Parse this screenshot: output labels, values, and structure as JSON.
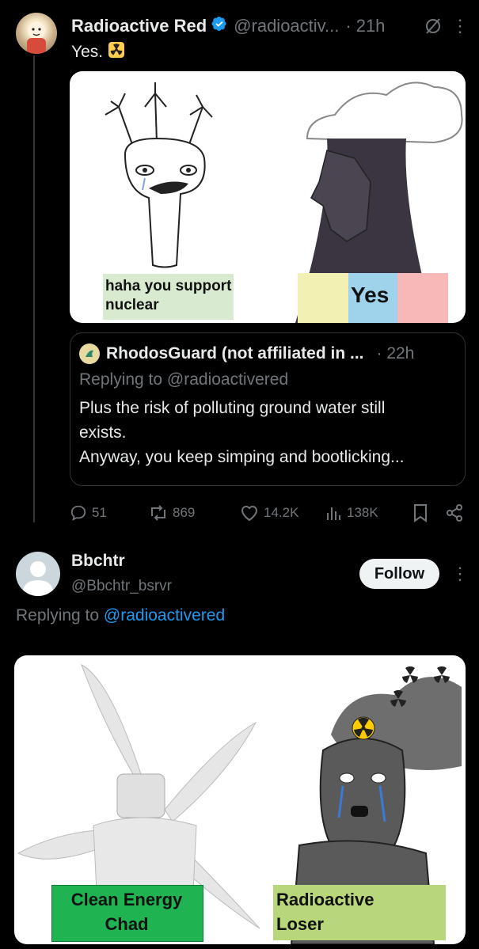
{
  "tweet": {
    "author_name": "Radioactive Red",
    "author_handle": "@radioactiv...",
    "time": "21h",
    "text": "Yes.",
    "meme": {
      "left_caption_line1": "haha you support",
      "left_caption_line2": "nuclear",
      "right_caption": "Yes"
    }
  },
  "quote": {
    "author_name": "RhodosGuard (not affiliated in ...",
    "time": "22h",
    "replying_to": "Replying to @radioactivered",
    "body_line1": "Plus the risk of polluting ground water still",
    "body_line2": "exists.",
    "body_line3": "Anyway, you keep simping and bootlicking..."
  },
  "actions": {
    "replies": "51",
    "reposts": "869",
    "likes": "14.2K",
    "views": "138K"
  },
  "reply": {
    "author_name": "Bbchtr",
    "author_handle": "@Bbchtr_bsrvr",
    "follow_label": "Follow",
    "replying_prefix": "Replying to",
    "replying_handle": "@radioactivered",
    "meme": {
      "left_caption_line1": "Clean Energy",
      "left_caption_line2": "Chad",
      "right_caption_line1": "Radioactive",
      "right_caption_line2": "Loser"
    }
  },
  "colors": {
    "background": "#000000",
    "text_primary": "#e7e9ea",
    "text_secondary": "#71767b",
    "link": "#1d9bf0",
    "verified": "#1d9bf0"
  }
}
